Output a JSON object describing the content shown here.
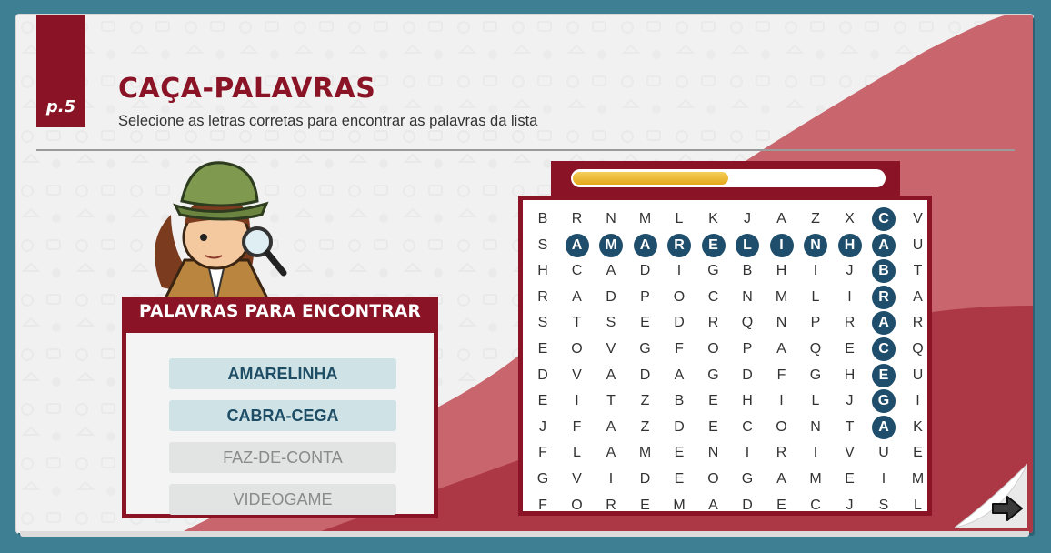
{
  "page": {
    "label": "p.5"
  },
  "header": {
    "title": "CAÇA-PALAVRAS",
    "subtitle": "Selecione as letras corretas para encontrar as palavras da lista"
  },
  "word_list": {
    "title": "PALAVRAS PARA ENCONTRAR",
    "words": [
      {
        "text": "AMARELINHA",
        "found": true
      },
      {
        "text": "CABRA-CEGA",
        "found": true
      },
      {
        "text": "FAZ-DE-CONTA",
        "found": false
      },
      {
        "text": "VIDEOGAME",
        "found": false
      }
    ]
  },
  "progress": {
    "value": 0.5
  },
  "grid": {
    "rows": [
      "BRNMLKJAZXCV",
      "SAMARELINHAU",
      "HCADIGBHIJBT",
      "RADPOCNMLIRA",
      "STSEDRQNPRAR",
      "EOVGFOPAQECQ",
      "DVADAGDFGHEU",
      "EITZBEHILJGI",
      "JFAZDECONTAK",
      "FLAMENIRIVUE",
      "GVIDEOGAMEIM",
      "FOREMADECJSL"
    ],
    "selected": [
      [
        0,
        10
      ],
      [
        1,
        1
      ],
      [
        1,
        2
      ],
      [
        1,
        3
      ],
      [
        1,
        4
      ],
      [
        1,
        5
      ],
      [
        1,
        6
      ],
      [
        1,
        7
      ],
      [
        1,
        8
      ],
      [
        1,
        9
      ],
      [
        1,
        10
      ],
      [
        2,
        10
      ],
      [
        3,
        10
      ],
      [
        4,
        10
      ],
      [
        5,
        10
      ],
      [
        6,
        10
      ],
      [
        7,
        10
      ],
      [
        8,
        10
      ]
    ]
  },
  "colors": {
    "brand": "#8a1426",
    "selected": "#1f4e6c",
    "progress": "#e9b62c"
  },
  "icons": {
    "next": "arrow-right-icon",
    "character": "detective-icon"
  }
}
